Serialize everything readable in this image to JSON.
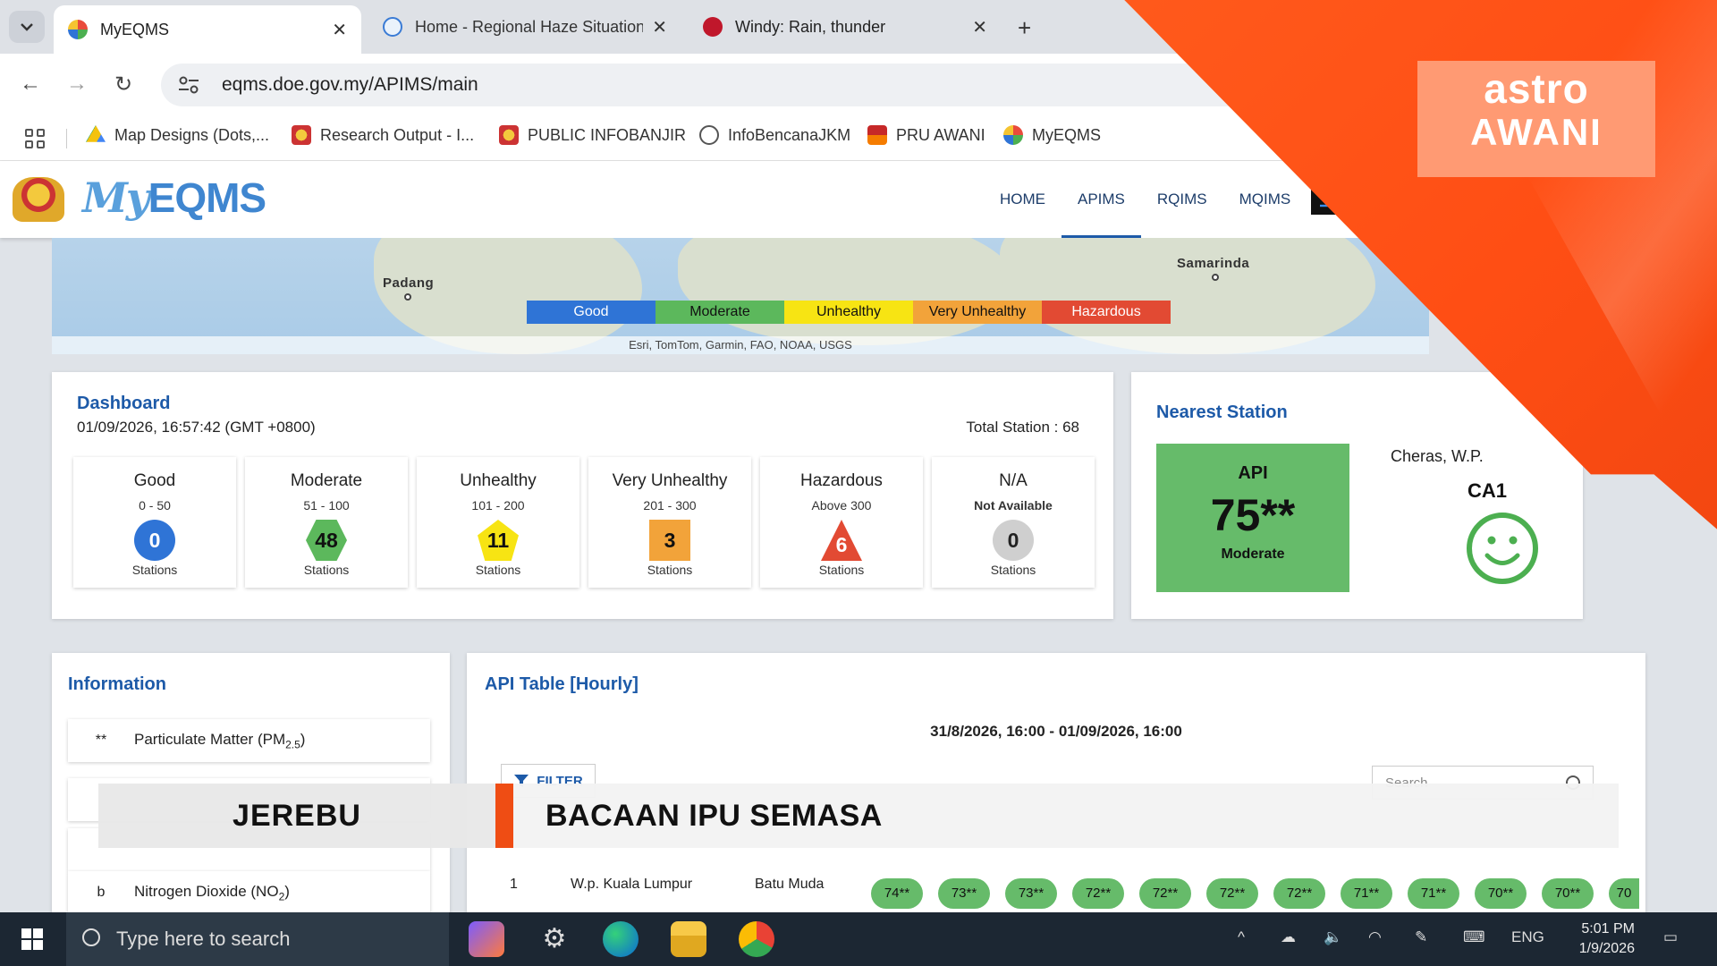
{
  "colors": {
    "good": "#2f74d6",
    "moderate": "#5cb85c",
    "unhealthy": "#f7e413",
    "very_unhealthy": "#f2a33a",
    "hazardous": "#e24a33",
    "na": "#cfcfcf",
    "brand_blue": "#1d5aa8",
    "astro_orange": "#ff5a1c"
  },
  "browser": {
    "tabs": [
      {
        "title": "MyEQMS",
        "icon": "myeqms-favicon",
        "active": true
      },
      {
        "title": "Home - Regional Haze Situation",
        "icon": "haze-favicon",
        "active": false
      },
      {
        "title": "Windy: Rain, thunder",
        "icon": "windy-favicon",
        "active": false
      }
    ],
    "url": "eqms.doe.gov.my/APIMS/main",
    "bookmarks": [
      {
        "label": "Map Designs (Dots,...",
        "icon": "drive-icon"
      },
      {
        "label": "Research Output - I...",
        "icon": "crest-icon"
      },
      {
        "label": "PUBLIC INFOBANJIR",
        "icon": "crest-icon"
      },
      {
        "label": "InfoBencanaJKM",
        "icon": "globe-icon"
      },
      {
        "label": "PRU AWANI",
        "icon": "flag-icon"
      },
      {
        "label": "MyEQMS",
        "icon": "myeqms-favicon"
      }
    ]
  },
  "site": {
    "logo_my": "My",
    "logo_eqms": "EQMS",
    "nav": [
      {
        "label": "HOME",
        "active": false
      },
      {
        "label": "APIMS",
        "active": true
      },
      {
        "label": "RQIMS",
        "active": false
      },
      {
        "label": "MQIMS",
        "active": false
      }
    ]
  },
  "map": {
    "labels": [
      "Padang",
      "Samarinda"
    ],
    "legend": [
      "Good",
      "Moderate",
      "Unhealthy",
      "Very Unhealthy",
      "Hazardous"
    ],
    "attribution": "Esri, TomTom, Garmin, FAO, NOAA, USGS"
  },
  "dashboard": {
    "title": "Dashboard",
    "datetime": "01/09/2026, 16:57:42 (GMT +0800)",
    "total_station": "Total Station : 68",
    "categories": [
      {
        "name": "Good",
        "range": "0 - 50",
        "count": "0",
        "unit": "Stations"
      },
      {
        "name": "Moderate",
        "range": "51 - 100",
        "count": "48",
        "unit": "Stations"
      },
      {
        "name": "Unhealthy",
        "range": "101 - 200",
        "count": "11",
        "unit": "Stations"
      },
      {
        "name": "Very Unhealthy",
        "range": "201 - 300",
        "count": "3",
        "unit": "Stations"
      },
      {
        "name": "Hazardous",
        "range": "Above 300",
        "count": "6",
        "unit": "Stations"
      },
      {
        "name": "N/A",
        "range": "Not Available",
        "count": "0",
        "unit": "Stations"
      }
    ]
  },
  "nearest": {
    "title": "Nearest Station",
    "api_label": "API",
    "api_value": "75**",
    "status": "Moderate",
    "location": "Cheras, W.P.",
    "code": "CA1",
    "face": "smiley-face-icon"
  },
  "information": {
    "title": "Information",
    "items": [
      {
        "symbol": "**",
        "label": "Particulate Matter (PM",
        "sub": "2.5",
        "suffix": ")"
      },
      {
        "symbol": "b",
        "label": "Nitrogen Dioxide (NO",
        "sub": "2",
        "suffix": ")"
      }
    ]
  },
  "api_table": {
    "title": "API Table [Hourly]",
    "range": "31/8/2026, 16:00 - 01/09/2026, 16:00",
    "filter_label": "FILTER",
    "search_placeholder": "Search",
    "row": {
      "no": "1",
      "state": "W.p. Kuala Lumpur",
      "station": "Batu Muda",
      "values": [
        "74**",
        "73**",
        "73**",
        "72**",
        "72**",
        "72**",
        "72**",
        "71**",
        "71**",
        "70**",
        "70**",
        "70"
      ]
    }
  },
  "overlay": {
    "logo_line1": "astro",
    "logo_line2": "AWANI",
    "lower_third_left": "JEREBU",
    "lower_third_right": "BACAAN IPU SEMASA"
  },
  "taskbar": {
    "search_placeholder": "Type here to search",
    "language": "ENG",
    "time": "5:01 PM",
    "date": "1/9/2026"
  }
}
